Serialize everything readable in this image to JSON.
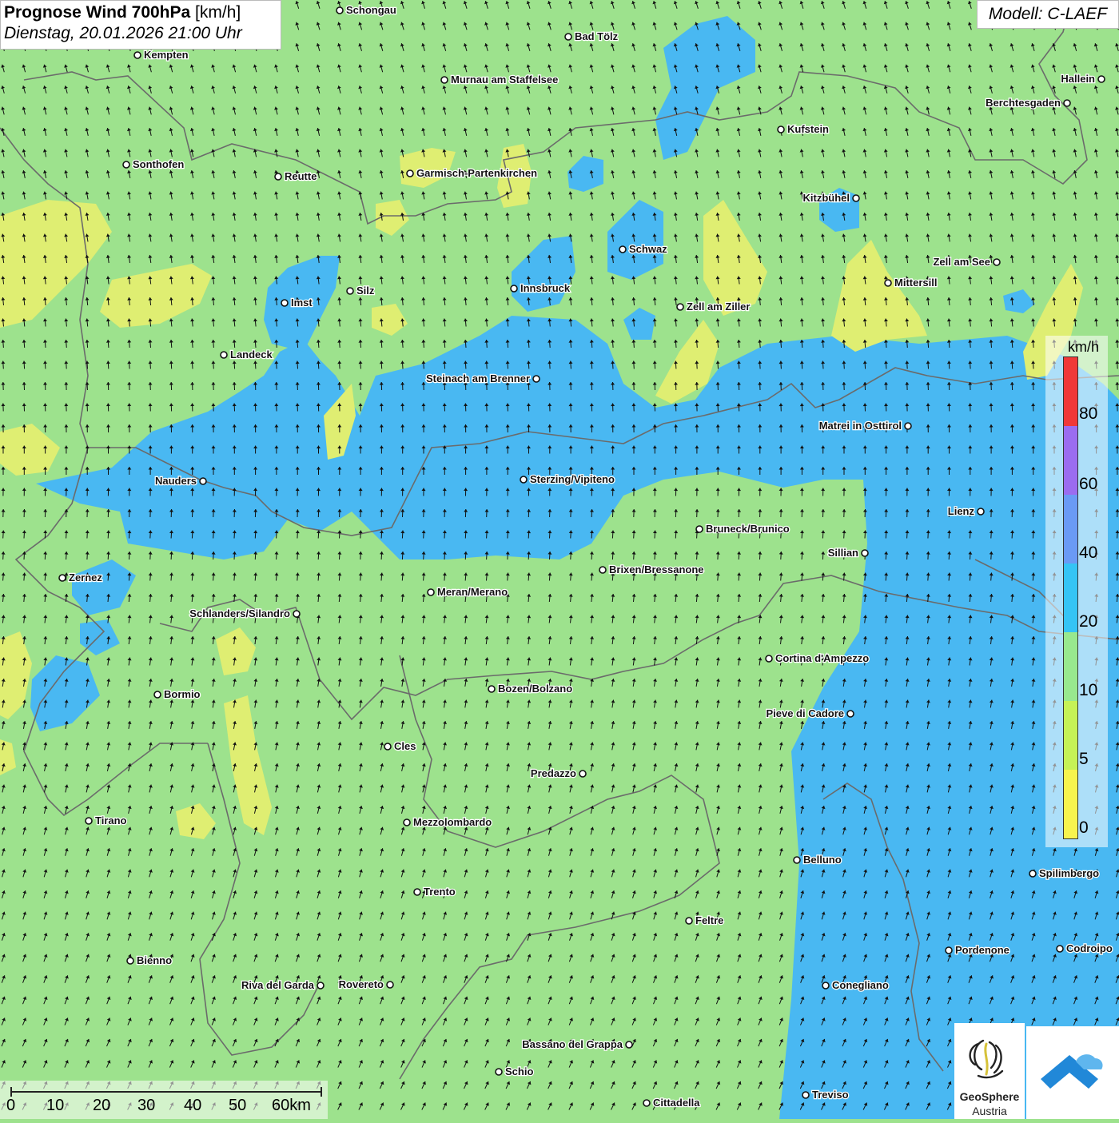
{
  "title": {
    "bold": "Prognose Wind 700hPa",
    "unit": "[km/h]",
    "datetime": "Dienstag, 20.01.2026 21:00 Uhr"
  },
  "model": "Modell: C-LAEF",
  "legend": {
    "unit": "km/h",
    "labels": [
      "80",
      "60",
      "40",
      "20",
      "10",
      "5",
      "0"
    ],
    "colors": [
      "#f03838",
      "#9b6cf0",
      "#6a9af5",
      "#35c4f5",
      "#98e88e",
      "#c6f256",
      "#f7f44e"
    ]
  },
  "scale": {
    "labels": [
      "0",
      "10",
      "20",
      "30",
      "40",
      "50",
      "60km"
    ]
  },
  "logo": {
    "name": "GeoSphere",
    "country": "Austria"
  },
  "colors": {
    "green_zone": "#9de28d",
    "blue_zone": "#49b8f2",
    "yellow_zone": "#dfee72",
    "border": "#6b6b6b"
  },
  "cities": [
    {
      "name": "Schongau"
    },
    {
      "name": "Bad Tölz"
    },
    {
      "name": "Kempten"
    },
    {
      "name": "Murnau am Staffelsee"
    },
    {
      "name": "Hallein"
    },
    {
      "name": "Berchtesgaden"
    },
    {
      "name": "Kufstein"
    },
    {
      "name": "Sonthofen"
    },
    {
      "name": "Reutte"
    },
    {
      "name": "Garmisch-Partenkirchen"
    },
    {
      "name": "Kitzbühel"
    },
    {
      "name": "Schwaz"
    },
    {
      "name": "Zell am See"
    },
    {
      "name": "Mittersill"
    },
    {
      "name": "Innsbruck"
    },
    {
      "name": "Imst"
    },
    {
      "name": "Silz"
    },
    {
      "name": "Zell am Ziller"
    },
    {
      "name": "Landeck"
    },
    {
      "name": "Steinach am Brenner"
    },
    {
      "name": "Matrei in Osttirol"
    },
    {
      "name": "Nauders"
    },
    {
      "name": "Sterzing/Vipiteno"
    },
    {
      "name": "Lienz"
    },
    {
      "name": "Bruneck/Brunico"
    },
    {
      "name": "Sillian"
    },
    {
      "name": "Zernez"
    },
    {
      "name": "Brixen/Bressanone"
    },
    {
      "name": "Meran/Merano"
    },
    {
      "name": "Schlanders/Silandro"
    },
    {
      "name": "Cortina d'Ampezzo"
    },
    {
      "name": "Bozen/Bolzano"
    },
    {
      "name": "Bormio"
    },
    {
      "name": "Pieve di Cadore"
    },
    {
      "name": "Cles"
    },
    {
      "name": "Predazzo"
    },
    {
      "name": "Tirano"
    },
    {
      "name": "Mezzolombardo"
    },
    {
      "name": "Belluno"
    },
    {
      "name": "Spilimbergo"
    },
    {
      "name": "Trento"
    },
    {
      "name": "Feltre"
    },
    {
      "name": "Pordenone"
    },
    {
      "name": "Codroipo"
    },
    {
      "name": "Bienno"
    },
    {
      "name": "Riva del Garda"
    },
    {
      "name": "Rovereto"
    },
    {
      "name": "Conegliano"
    },
    {
      "name": "Bassano del Grappa"
    },
    {
      "name": "Schio"
    },
    {
      "name": "Treviso"
    },
    {
      "name": "Cittadella"
    }
  ]
}
